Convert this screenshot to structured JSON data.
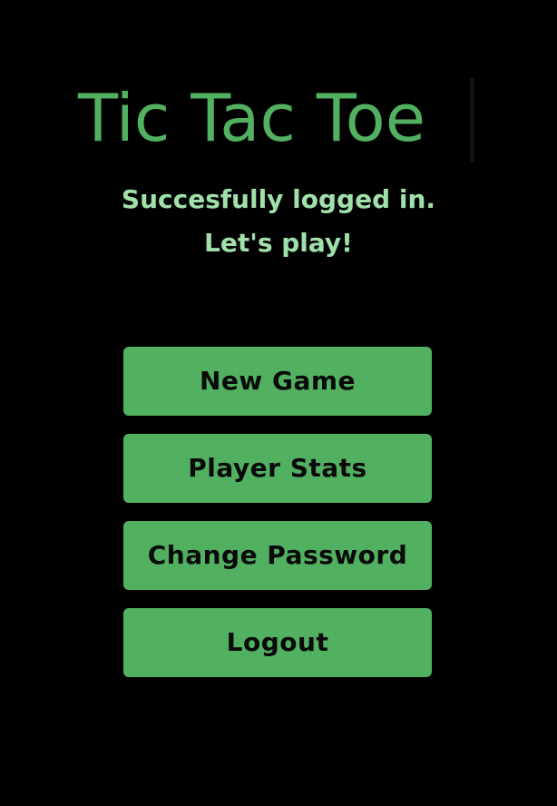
{
  "app": {
    "title": "Tic Tac Toe"
  },
  "status": {
    "line1": "Succesfully logged in.",
    "line2": "Let's play!"
  },
  "menu": {
    "new_game": "New Game",
    "player_stats": "Player Stats",
    "change_password": "Change Password",
    "logout": "Logout"
  },
  "colors": {
    "background": "#000000",
    "accent": "#52b061",
    "subtitle": "#9fe0ab",
    "button_text": "#0a0a0a"
  }
}
